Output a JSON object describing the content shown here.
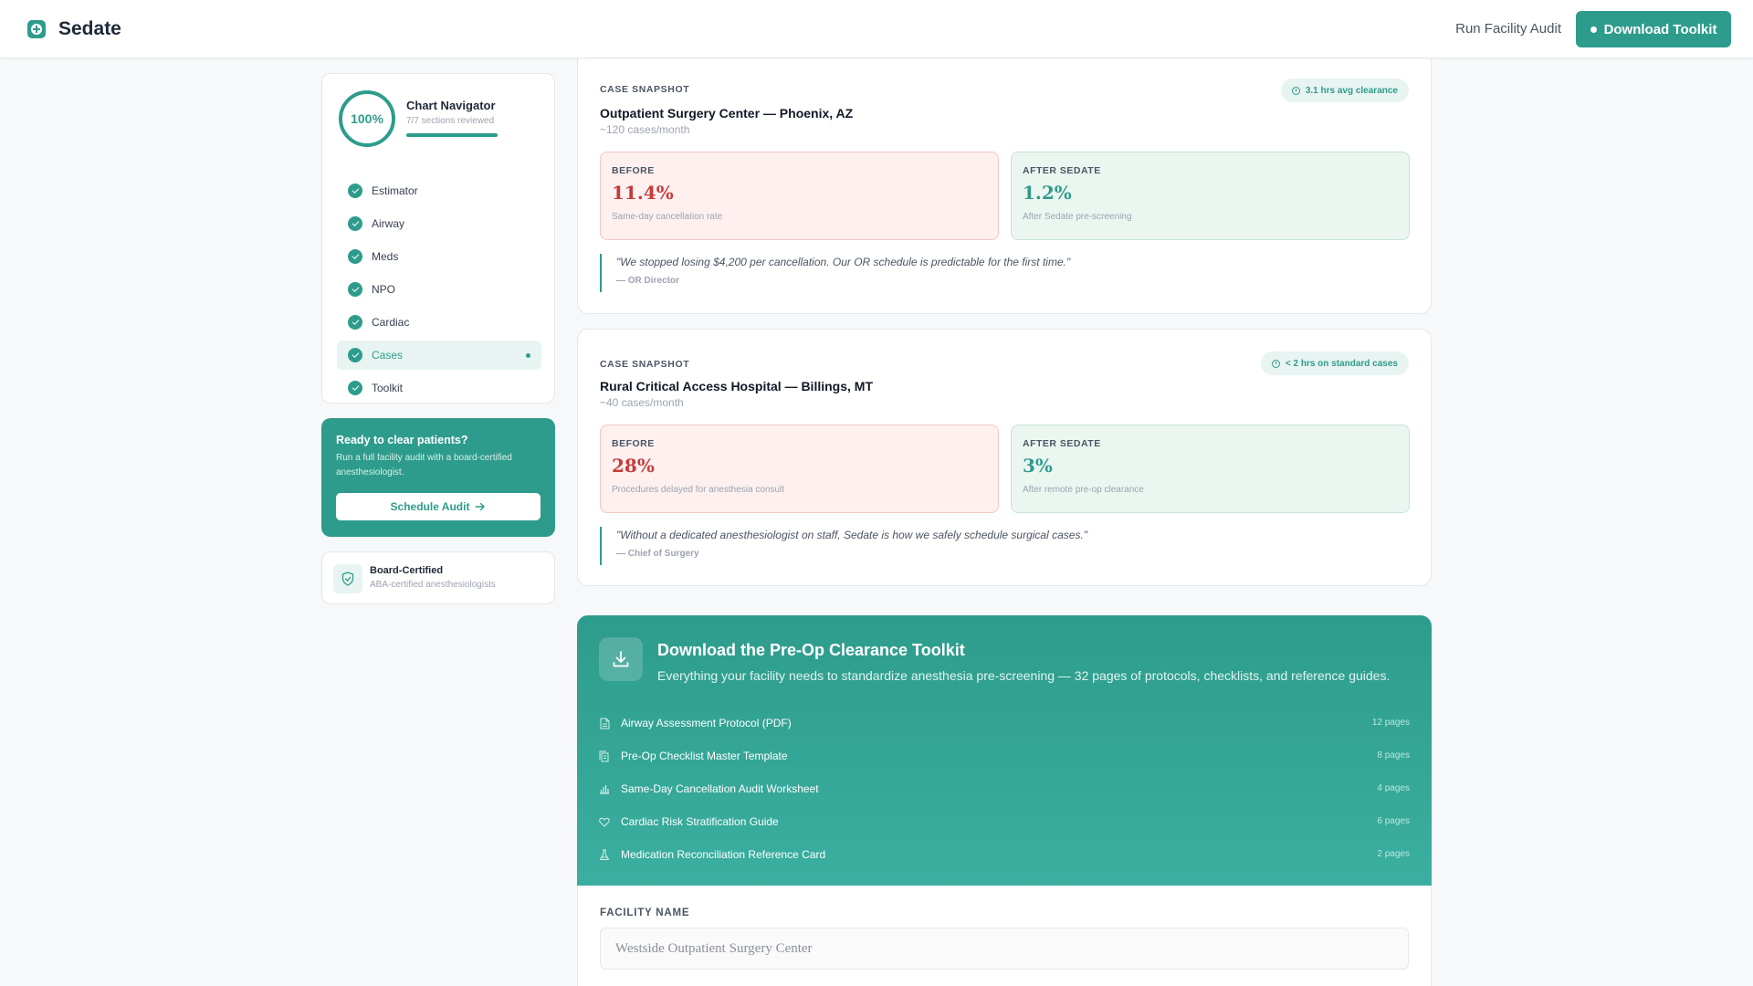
{
  "header": {
    "brand": "Sedate",
    "link_label": "Run Facility Audit",
    "button_label": "Download Toolkit"
  },
  "navigator": {
    "progress_label": "100%",
    "progress_fraction": 1.0,
    "title": "Chart Navigator",
    "subtitle": "7/7 sections reviewed",
    "items": [
      {
        "label": "Estimator"
      },
      {
        "label": "Airway"
      },
      {
        "label": "Meds"
      },
      {
        "label": "NPO"
      },
      {
        "label": "Cardiac"
      },
      {
        "label": "Cases",
        "active": true
      },
      {
        "label": "Toolkit"
      }
    ]
  },
  "cta": {
    "title": "Ready to clear patients?",
    "text": "Run a full facility audit with a board-certified anesthesiologist.",
    "button_label": "Schedule Audit"
  },
  "certification": {
    "title": "Board-Certified",
    "subtitle": "ABA-certified anesthesiologists"
  },
  "cases": [
    {
      "label": "CASE SNAPSHOT",
      "badge": "3.1 hrs avg clearance",
      "title": "Outpatient Surgery Center — Phoenix, AZ",
      "volume": "~120 cases/month",
      "before": {
        "label": "BEFORE",
        "value": "11.4%",
        "note": "Same-day cancellation rate"
      },
      "after": {
        "label": "AFTER SEDATE",
        "value": "1.2%",
        "note": "After Sedate pre-screening"
      },
      "quote": "\"We stopped losing $4,200 per cancellation. Our OR schedule is predictable for the first time.\"",
      "attribution": "— OR Director"
    },
    {
      "label": "CASE SNAPSHOT",
      "badge": "< 2 hrs on standard cases",
      "title": "Rural Critical Access Hospital — Billings, MT",
      "volume": "~40 cases/month",
      "before": {
        "label": "BEFORE",
        "value": "28%",
        "note": "Procedures delayed for anesthesia consult"
      },
      "after": {
        "label": "AFTER SEDATE",
        "value": "3%",
        "note": "After remote pre-op clearance"
      },
      "quote": "\"Without a dedicated anesthesiologist on staff, Sedate is how we safely schedule surgical cases.\"",
      "attribution": "— Chief of Surgery"
    }
  ],
  "toolkit": {
    "title": "Download the Pre-Op Clearance Toolkit",
    "subtitle": "Everything your facility needs to standardize anesthesia pre-screening — 32 pages of protocols, checklists, and reference guides.",
    "items": [
      {
        "label": "Airway Assessment Protocol (PDF)",
        "pages": "12 pages",
        "icon": "document-icon"
      },
      {
        "label": "Pre-Op Checklist Master Template",
        "pages": "8 pages",
        "icon": "copy-icon"
      },
      {
        "label": "Same-Day Cancellation Audit Worksheet",
        "pages": "4 pages",
        "icon": "bar-chart-icon"
      },
      {
        "label": "Cardiac Risk Stratification Guide",
        "pages": "6 pages",
        "icon": "heart-icon"
      },
      {
        "label": "Medication Reconciliation Reference Card",
        "pages": "2 pages",
        "icon": "flask-icon"
      }
    ]
  },
  "form": {
    "facility_label": "FACILITY NAME",
    "facility_placeholder": "Westside Outpatient Surgery Center"
  },
  "colors": {
    "accent": "#2e9c8c",
    "before_red": "#c53b3b",
    "before_bg": "#fdf0ef",
    "after_bg": "#ebf6f1"
  }
}
